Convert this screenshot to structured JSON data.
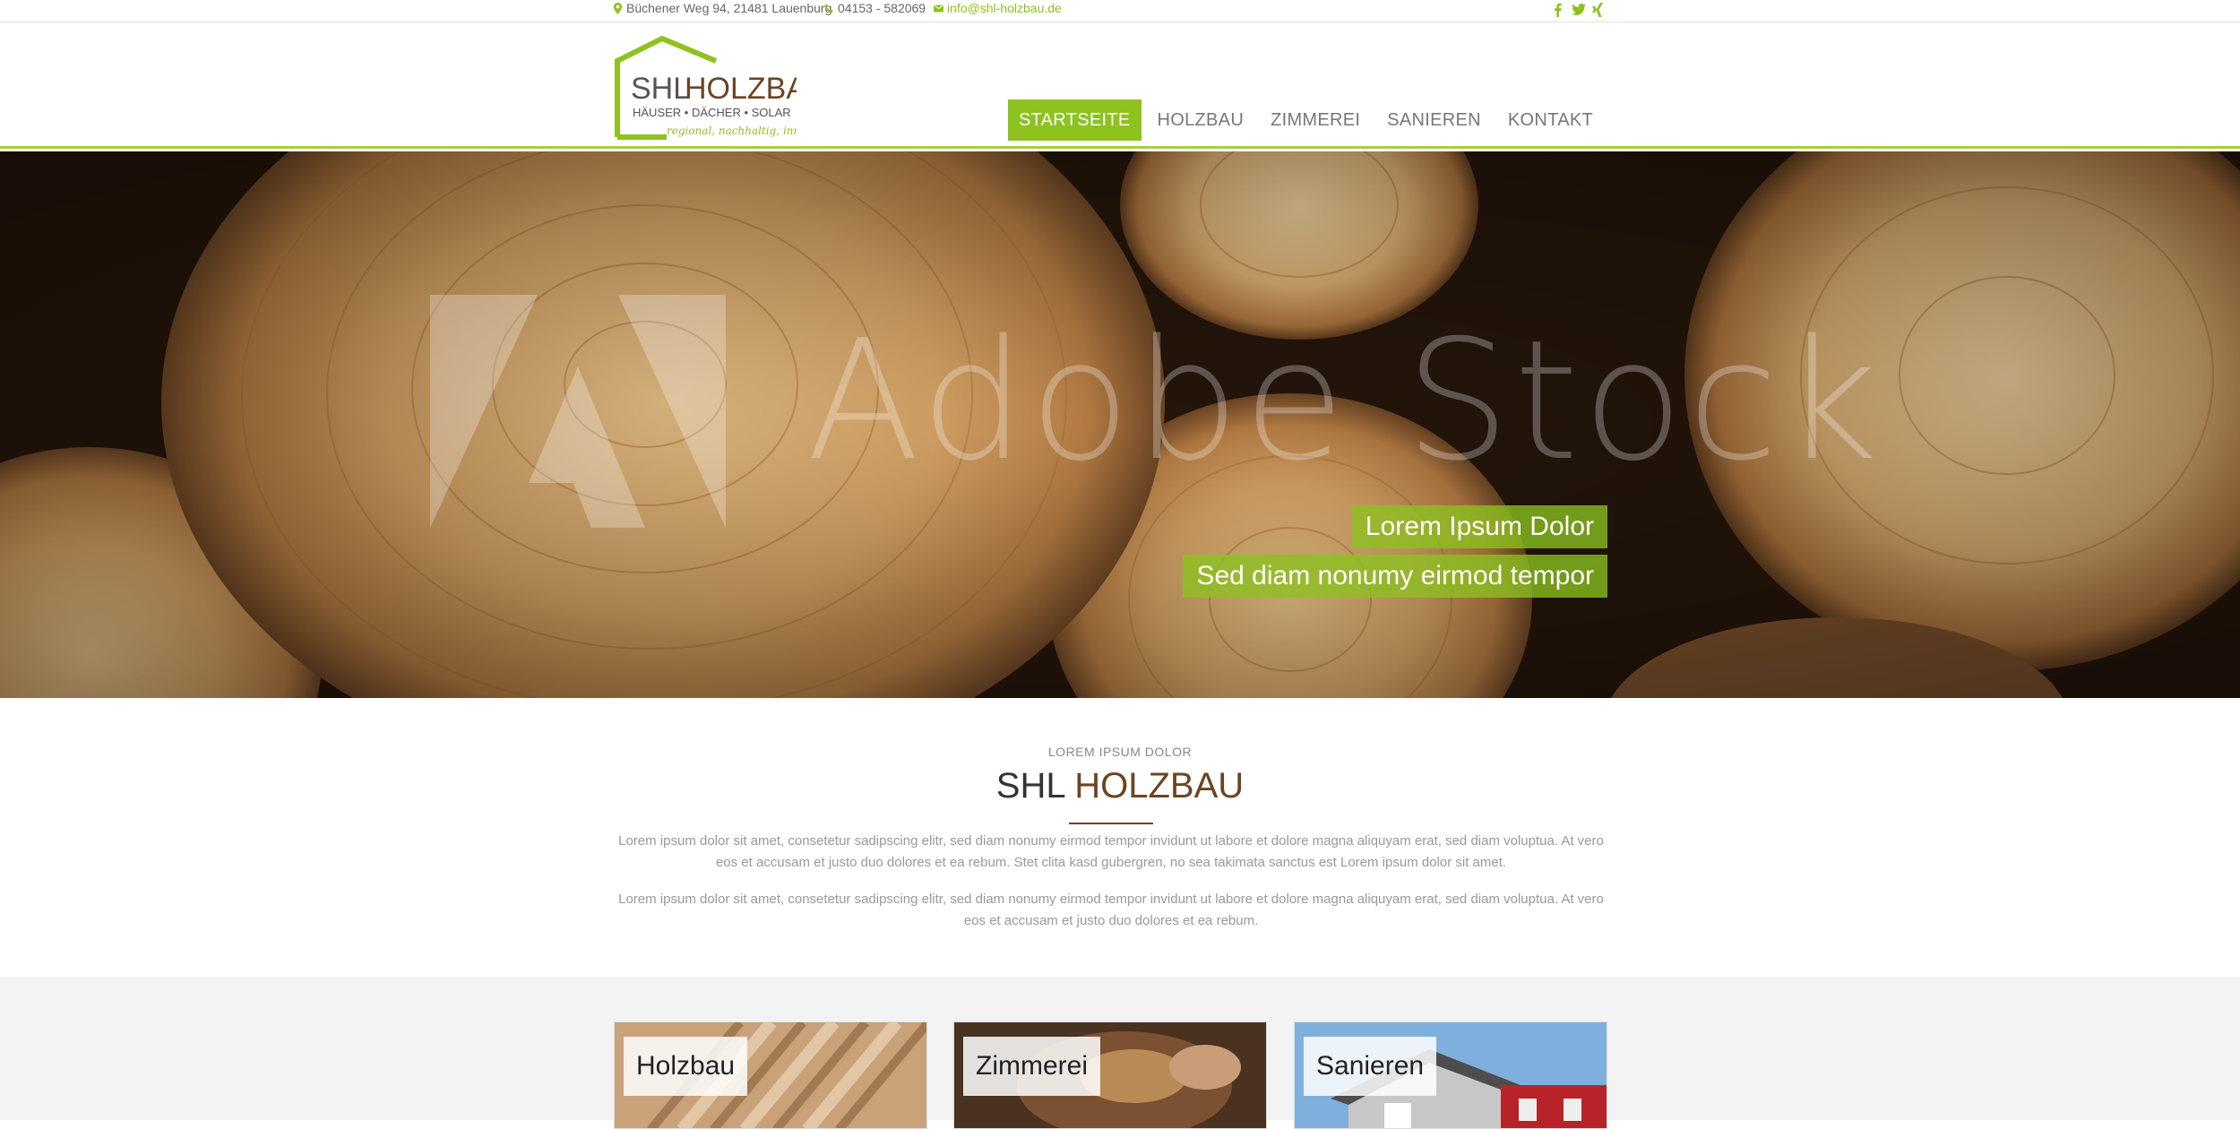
{
  "topbar": {
    "address": "Büchener Weg 94, 21481 Lauenburg",
    "phone": "04153 - 582069",
    "email": "info@shl-holzbau.de",
    "social": [
      "facebook-icon",
      "twitter-icon",
      "xing-icon"
    ]
  },
  "logo": {
    "brand_a": "SHL",
    "brand_b": "HOLZBAU",
    "tagline": "HÄUSER  •  DÄCHER  •  SOLAR",
    "slogan": "regional, nachhaltig, innovativ"
  },
  "nav": {
    "items": [
      "STARTSEITE",
      "HOLZBAU",
      "ZIMMEREI",
      "SANIEREN",
      "KONTAKT"
    ],
    "active": "STARTSEITE"
  },
  "hero": {
    "watermark": "Adobe Stock",
    "caption1": "Lorem Ipsum Dolor",
    "caption2": "Sed diam nonumy eirmod tempor"
  },
  "intro": {
    "kicker": "LOREM IPSUM DOLOR",
    "title_a": "SHL ",
    "title_b": "HOLZBAU",
    "paragraph1": "Lorem ipsum dolor sit amet, consetetur sadipscing elitr, sed diam nonumy eirmod tempor invidunt ut labore et dolore magna aliquyam erat, sed diam voluptua. At vero eos et accusam et justo duo dolores et ea rebum. Stet clita kasd gubergren, no sea takimata sanctus est Lorem ipsum dolor sit amet.",
    "paragraph2": "Lorem ipsum dolor sit amet, consetetur sadipscing elitr, sed diam nonumy eirmod tempor invidunt ut labore et dolore magna aliquyam erat, sed diam voluptua. At vero eos et accusam et justo duo dolores et ea rebum."
  },
  "cards": [
    "Holzbau",
    "Zimmerei",
    "Sanieren"
  ],
  "colors": {
    "accent": "#8dc21f",
    "brown": "#6b4423",
    "header_border": "#a7cf3b"
  }
}
